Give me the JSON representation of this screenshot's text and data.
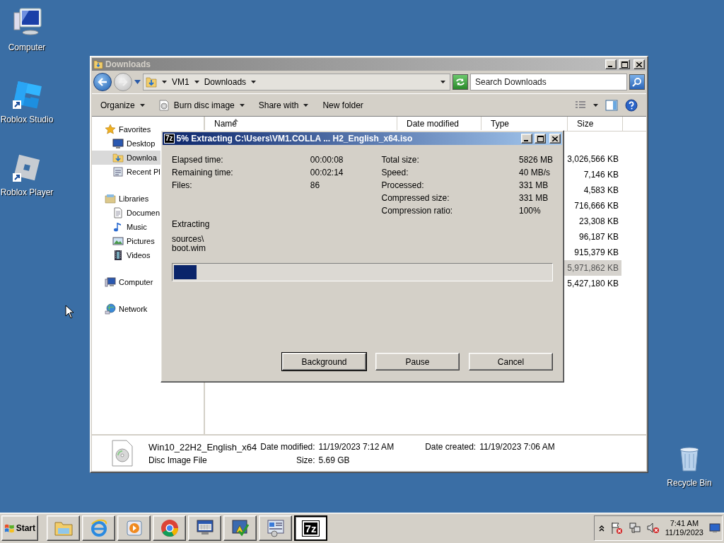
{
  "desktop_icons": [
    {
      "kind": "computer",
      "label": "Computer",
      "shortcut": false
    },
    {
      "kind": "studio",
      "label": "Roblox Studio",
      "shortcut": true
    },
    {
      "kind": "player",
      "label": "Roblox Player",
      "shortcut": true
    },
    {
      "kind": "recycle",
      "label": "Recycle Bin",
      "shortcut": false
    }
  ],
  "explorer": {
    "title": "Downloads",
    "active": false,
    "breadcrumb": [
      "VM1",
      "Downloads"
    ],
    "search": {
      "placeholder": "Search Downloads"
    },
    "toolbar": [
      {
        "kind": "menu",
        "label": "Organize"
      },
      {
        "kind": "burn",
        "label": "Burn disc image"
      },
      {
        "kind": "menu",
        "label": "Share with"
      },
      {
        "kind": "plain",
        "label": "New folder"
      }
    ],
    "nav": [
      {
        "kind": "favorites",
        "label": "Favorites",
        "children": [
          {
            "kind": "desktop",
            "label": "Desktop",
            "selected": false
          },
          {
            "kind": "downloads",
            "label": "Downloa",
            "selected": true
          },
          {
            "kind": "recent",
            "label": "Recent Pl",
            "selected": false
          }
        ]
      },
      {
        "kind": "libraries",
        "label": "Libraries",
        "children": [
          {
            "kind": "documents",
            "label": "Documen",
            "selected": false
          },
          {
            "kind": "music",
            "label": "Music",
            "selected": false
          },
          {
            "kind": "pictures",
            "label": "Pictures",
            "selected": false
          },
          {
            "kind": "videos",
            "label": "Videos",
            "selected": false
          }
        ]
      },
      {
        "kind": "computer",
        "label": "Computer"
      },
      {
        "kind": "network",
        "label": "Network"
      }
    ],
    "columns": [
      {
        "label": "Name",
        "sorted": true
      },
      {
        "label": "Date modified",
        "sorted": false
      },
      {
        "label": "Type",
        "sorted": false
      },
      {
        "label": "Size",
        "sorted": false
      }
    ],
    "rows": [
      {
        "size": "3,026,566 KB",
        "selected": false
      },
      {
        "size": "7,146 KB",
        "selected": false
      },
      {
        "size": "4,583 KB",
        "selected": false
      },
      {
        "size": "716,666 KB",
        "selected": false
      },
      {
        "size": "23,308 KB",
        "selected": false
      },
      {
        "size": "96,187 KB",
        "selected": false
      },
      {
        "size": "915,379 KB",
        "selected": false
      },
      {
        "size": "5,971,862 KB",
        "selected": true
      },
      {
        "size": "5,427,180 KB",
        "selected": false
      }
    ],
    "details": {
      "name": "Win10_22H2_English_x64",
      "type": "Disc Image File",
      "modified_label": "Date modified:",
      "modified": "11/19/2023 7:12 AM",
      "size_label": "Size:",
      "size": "5.69 GB",
      "created_label": "Date created:",
      "created": "11/19/2023 7:06 AM"
    }
  },
  "dialog": {
    "icon_text": "7z",
    "title": "5% Extracting C:\\Users\\VM1.COLLA ... H2_English_x64.iso",
    "active": true,
    "stats_left": [
      {
        "label": "Elapsed time:",
        "value": "00:00:08"
      },
      {
        "label": "Remaining time:",
        "value": "00:02:14"
      },
      {
        "label": "Files:",
        "value": "86"
      }
    ],
    "stats_right": [
      {
        "label": "Total size:",
        "value": "5826 MB"
      },
      {
        "label": "Speed:",
        "value": "40 MB/s"
      },
      {
        "label": "Processed:",
        "value": "331 MB"
      },
      {
        "label": "Compressed size:",
        "value": "331 MB"
      },
      {
        "label": "Compression ratio:",
        "value": "100%"
      }
    ],
    "status": "Extracting",
    "current_path": [
      "sources\\",
      "boot.wim"
    ],
    "progress": {
      "level": 0.06
    },
    "buttons": [
      {
        "label": "Background",
        "focused": true
      },
      {
        "label": "Pause",
        "focused": false
      },
      {
        "label": "Cancel",
        "focused": false
      }
    ]
  },
  "taskbar": {
    "start": "Start",
    "tasks": [
      {
        "kind": "explorer",
        "selected": false
      },
      {
        "kind": "ie",
        "selected": false
      },
      {
        "kind": "media",
        "selected": false
      },
      {
        "kind": "chrome",
        "selected": false
      },
      {
        "kind": "keyboard",
        "selected": false
      },
      {
        "kind": "action",
        "selected": false
      },
      {
        "kind": "control",
        "selected": false
      },
      {
        "kind": "sevenzip",
        "label": "7z",
        "selected": true
      }
    ],
    "clock": {
      "time": "7:41 AM",
      "date": "11/19/2023"
    }
  }
}
